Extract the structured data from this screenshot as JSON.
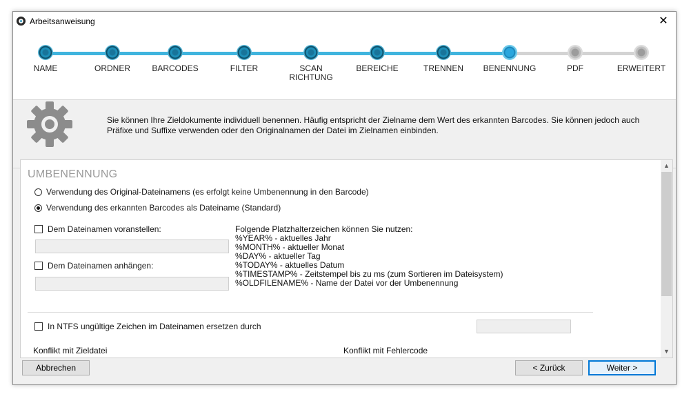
{
  "window": {
    "title": "Arbeitsanweisung",
    "close_label": "✕"
  },
  "steps": [
    {
      "label": "NAME",
      "state": "done"
    },
    {
      "label": "ORDNER",
      "state": "done"
    },
    {
      "label": "BARCODES",
      "state": "done"
    },
    {
      "label": "FILTER",
      "state": "done"
    },
    {
      "label": "SCAN\nRICHTUNG",
      "state": "done"
    },
    {
      "label": "BEREICHE",
      "state": "done"
    },
    {
      "label": "TRENNEN",
      "state": "done"
    },
    {
      "label": "BENENNUNG",
      "state": "current"
    },
    {
      "label": "PDF",
      "state": "todo"
    },
    {
      "label": "ERWEITERT",
      "state": "todo"
    }
  ],
  "info": {
    "text": "Sie können Ihre Zieldokumente individuell benennen. Häufig entspricht der Zielname dem Wert des erkannten Barcodes. Sie können jedoch auch Präfixe und Suffixe verwenden oder den Originalnamen der Datei im Zielnamen einbinden."
  },
  "form": {
    "section_title": "UMBENENNUNG",
    "radio_original": "Verwendung des Original-Dateinamens (es erfolgt keine Umbenennung in den Barcode)",
    "radio_barcode": "Verwendung des erkannten Barcodes als Dateiname (Standard)",
    "prefix_label": "Dem Dateinamen voranstellen:",
    "prefix_value": "",
    "suffix_label": "Dem Dateinamen anhängen:",
    "suffix_value": "",
    "placeholders_title": "Folgende Platzhalterzeichen können Sie nutzen:",
    "placeholders": [
      "%YEAR% - aktuelles Jahr",
      "%MONTH% - aktueller Monat",
      "%DAY% - aktueller Tag",
      "%TODAY% - aktuelles Datum",
      "%TIMESTAMP% - Zeitstempel bis zu ms (zum Sortieren im Dateisystem)",
      "%OLDFILENAME% - Name der Datei vor der Umbenennung"
    ],
    "ntfs_label": "In NTFS ungültige Zeichen im Dateinamen ersetzen durch",
    "ntfs_value": "",
    "cut_left": "Konflikt mit Zieldatei",
    "cut_right": "Konflikt mit Fehlercode"
  },
  "buttons": {
    "cancel": "Abbrechen",
    "back": "< Zurück",
    "next": "Weiter >"
  },
  "colors": {
    "accent": "#1d8fb8",
    "line_done": "#3fb4de",
    "line_todo": "#d3d3d3"
  }
}
